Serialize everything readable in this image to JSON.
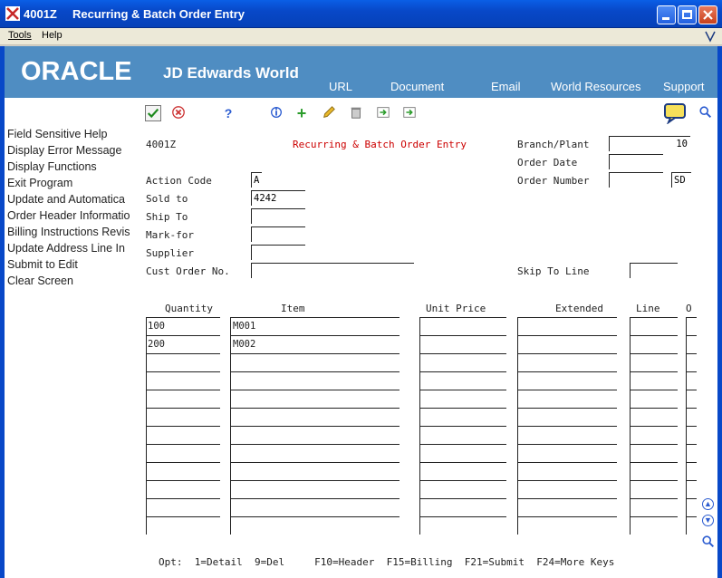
{
  "window": {
    "code": "4001Z",
    "title": "Recurring & Batch Order Entry"
  },
  "menu": {
    "tools": "Tools",
    "help": "Help"
  },
  "header": {
    "oracle": "ORACLE",
    "product": "JD Edwards World",
    "links": [
      "URL",
      "Document",
      "Email",
      "World Resources",
      "Support"
    ]
  },
  "sidebar": {
    "items": [
      "Field Sensitive Help",
      "Display Error Message",
      "Display Functions",
      "Exit Program",
      "Update and Automatica",
      "Order Header Informatio",
      "Billing Instructions Revis",
      "Update Address Line In",
      "Submit to Edit",
      "Clear Screen"
    ]
  },
  "form": {
    "program_id": "4001Z",
    "screen_title": "Recurring & Batch Order Entry",
    "branch_plant_label": "Branch/Plant",
    "branch_plant_value": "10",
    "order_date_label": "Order Date",
    "order_date_value": "",
    "order_number_label": "Order Number",
    "order_number_value": "",
    "order_type_value": "SD",
    "action_code_label": "Action Code",
    "action_code_value": "A",
    "sold_to_label": "Sold to",
    "sold_to_value": "4242",
    "ship_to_label": "Ship To",
    "ship_to_value": "",
    "mark_for_label": "Mark-for",
    "mark_for_value": "",
    "supplier_label": "Supplier",
    "supplier_value": "",
    "cust_order_label": "Cust Order No.",
    "cust_order_value": "",
    "skip_to_line_label": "Skip To Line",
    "skip_to_line_value": ""
  },
  "grid": {
    "columns": [
      "Quantity",
      "Item",
      "Unit Price",
      "Extended",
      "Line",
      "O"
    ],
    "rows": [
      {
        "quantity": "100",
        "item": "M001"
      },
      {
        "quantity": "200",
        "item": "M002"
      }
    ]
  },
  "footer": "Opt:  1=Detail  9=Del     F10=Header  F15=Billing  F21=Submit  F24=More Keys",
  "colors": {
    "title_bar": "#0848c8",
    "header_band": "#4f8dc2",
    "screen_title": "#cc0000"
  },
  "icons": [
    "check-icon",
    "cancel-icon",
    "help-icon",
    "info-icon",
    "add-icon",
    "pencil-icon",
    "delete-icon",
    "export-icon",
    "import-icon",
    "chat-icon",
    "search-icon"
  ]
}
